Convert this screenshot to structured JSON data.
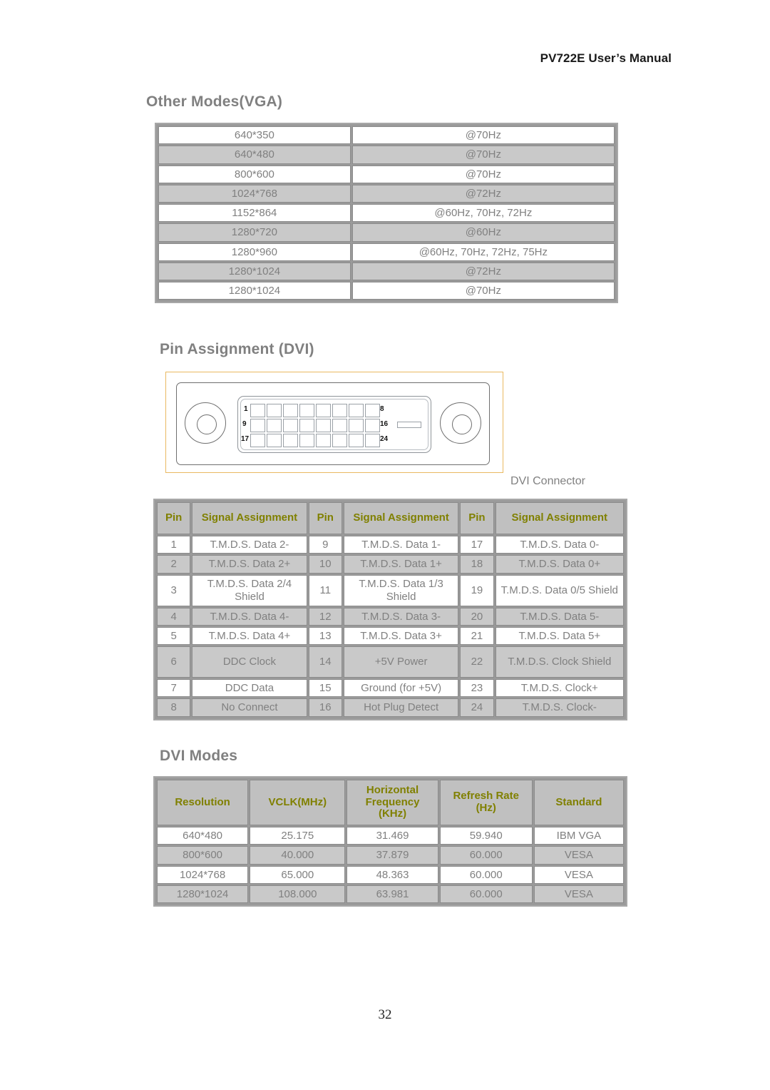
{
  "document": {
    "running_header": "PV722E User’s Manual",
    "page_number": "32"
  },
  "sections": {
    "vga": {
      "heading": "Other Modes(VGA)"
    },
    "pin": {
      "heading": "Pin Assignment (DVI)",
      "figure_caption": "DVI Connector"
    },
    "dvi_modes": {
      "heading": "DVI Modes"
    }
  },
  "vga_table": {
    "rows": [
      {
        "resolution": "640*350",
        "frequency": "@70Hz"
      },
      {
        "resolution": "640*480",
        "frequency": "@70Hz"
      },
      {
        "resolution": "800*600",
        "frequency": "@70Hz"
      },
      {
        "resolution": "1024*768",
        "frequency": "@72Hz"
      },
      {
        "resolution": "1152*864",
        "frequency": "@60Hz, 70Hz, 72Hz"
      },
      {
        "resolution": "1280*720",
        "frequency": "@60Hz"
      },
      {
        "resolution": "1280*960",
        "frequency": "@60Hz, 70Hz, 72Hz, 75Hz"
      },
      {
        "resolution": "1280*1024",
        "frequency": "@72Hz"
      },
      {
        "resolution": "1280*1024",
        "frequency": "@70Hz"
      }
    ]
  },
  "connector_figure": {
    "pin_labels": {
      "top_left": "1",
      "top_right": "8",
      "middle_left": "9",
      "middle_right": "16",
      "bottom_left": "17",
      "bottom_right": "24"
    },
    "pin_rows": 3,
    "pin_columns": 8,
    "frame_border_color": "#eab961"
  },
  "pin_table": {
    "headers": {
      "pin1": "Pin",
      "signal1": "Signal Assignment",
      "pin2": "Pin",
      "signal2": "Signal Assignment",
      "pin3": "Pin",
      "signal3": "Signal Assignment"
    },
    "rows": [
      {
        "pin_a": "1",
        "sig_a": "T.M.D.S. Data 2-",
        "pin_b": "9",
        "sig_b": "T.M.D.S. Data 1-",
        "pin_c": "17",
        "sig_c": "T.M.D.S. Data 0-"
      },
      {
        "pin_a": "2",
        "sig_a": "T.M.D.S. Data 2+",
        "pin_b": "10",
        "sig_b": "T.M.D.S. Data 1+",
        "pin_c": "18",
        "sig_c": "T.M.D.S. Data 0+"
      },
      {
        "pin_a": "3",
        "sig_a": "T.M.D.S. Data 2/4 Shield",
        "pin_b": "11",
        "sig_b": "T.M.D.S. Data 1/3 Shield",
        "pin_c": "19",
        "sig_c": "T.M.D.S. Data 0/5 Shield"
      },
      {
        "pin_a": "4",
        "sig_a": "T.M.D.S. Data 4-",
        "pin_b": "12",
        "sig_b": "T.M.D.S. Data 3-",
        "pin_c": "20",
        "sig_c": "T.M.D.S. Data 5-"
      },
      {
        "pin_a": "5",
        "sig_a": "T.M.D.S. Data 4+",
        "pin_b": "13",
        "sig_b": "T.M.D.S. Data 3+",
        "pin_c": "21",
        "sig_c": "T.M.D.S. Data 5+"
      },
      {
        "pin_a": "6",
        "sig_a": "DDC Clock",
        "pin_b": "14",
        "sig_b": "+5V Power",
        "pin_c": "22",
        "sig_c": "T.M.D.S. Clock Shield"
      },
      {
        "pin_a": "7",
        "sig_a": "DDC Data",
        "pin_b": "15",
        "sig_b": "Ground (for +5V)",
        "pin_c": "23",
        "sig_c": "T.M.D.S. Clock+"
      },
      {
        "pin_a": "8",
        "sig_a": "No Connect",
        "pin_b": "16",
        "sig_b": "Hot Plug Detect",
        "pin_c": "24",
        "sig_c": "T.M.D.S. Clock-"
      }
    ]
  },
  "dvi_modes_table": {
    "headers": {
      "resolution": "Resolution",
      "vclk": "VCLK(MHz)",
      "hfreq": "Horizontal Frequency (KHz)",
      "refresh": "Refresh Rate (Hz)",
      "standard": "Standard"
    },
    "rows": [
      {
        "resolution": "640*480",
        "vclk": "25.175",
        "hfreq": "31.469",
        "refresh": "59.940",
        "standard": "IBM VGA"
      },
      {
        "resolution": "800*600",
        "vclk": "40.000",
        "hfreq": "37.879",
        "refresh": "60.000",
        "standard": "VESA"
      },
      {
        "resolution": "1024*768",
        "vclk": "65.000",
        "hfreq": "48.363",
        "refresh": "60.000",
        "standard": "VESA"
      },
      {
        "resolution": "1280*1024",
        "vclk": "108.000",
        "hfreq": "63.981",
        "refresh": "60.000",
        "standard": "VESA"
      }
    ]
  },
  "colors": {
    "header_text": "#808000",
    "body_text": "#808080",
    "header_cell_bg": "#c0c0c0",
    "alt_row_bg": "#c9c9c9",
    "figure_border": "#eab961"
  }
}
